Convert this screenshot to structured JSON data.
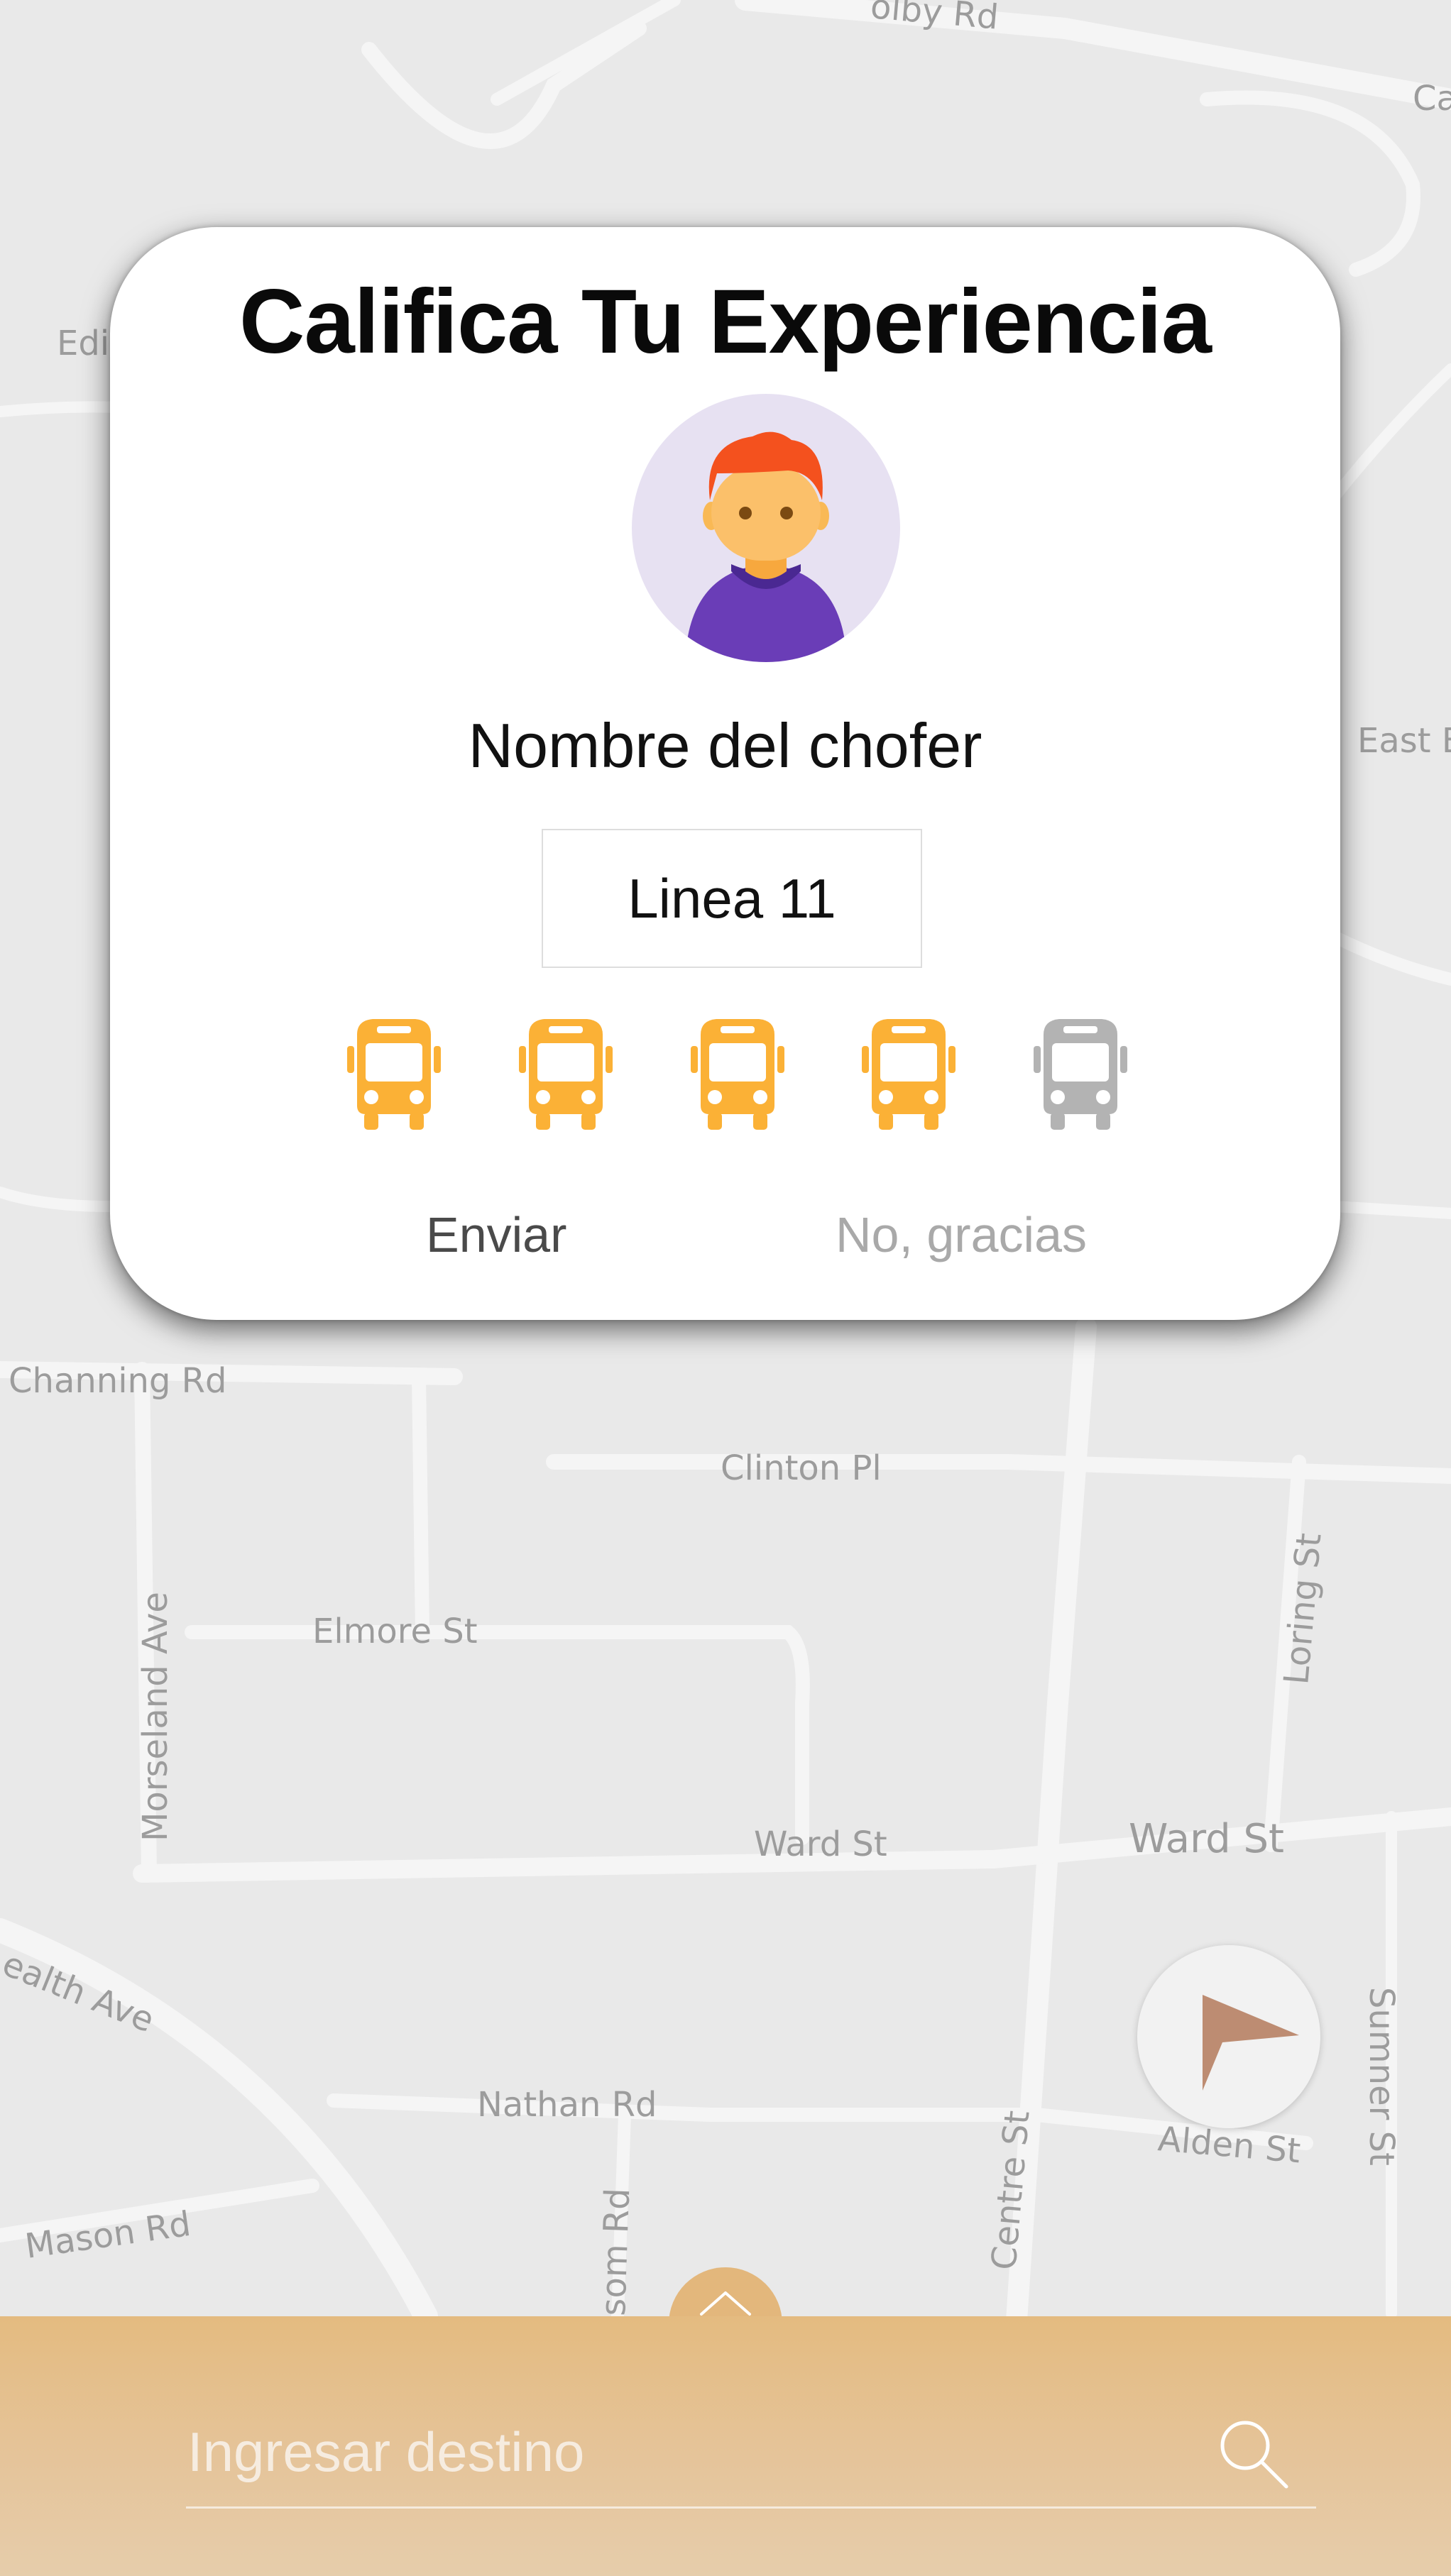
{
  "modal": {
    "title": "Califica Tu Experiencia",
    "driver_name": "Nombre del chofer",
    "route": "Linea 11",
    "rating": {
      "value": 4,
      "max": 5
    },
    "send_label": "Enviar",
    "dismiss_label": "No, gracias"
  },
  "map": {
    "streets": [
      "Channing Rd",
      "Clinton Pl",
      "Elmore St",
      "Morseland Ave",
      "Loring St",
      "Ward St",
      "Ward St",
      "ealth Ave",
      "Nathan Rd",
      "Alden St",
      "Sumner St",
      "Centre St",
      "Mason Rd",
      "som Rd",
      "East Buryi",
      "Edi",
      "Ca",
      "olby Rd"
    ]
  },
  "search": {
    "placeholder": "Ingresar destino",
    "value": ""
  },
  "icons": {
    "rating_icon": "bus-icon",
    "locate_icon": "navigation-arrow-icon",
    "expand_icon": "chevron-up-icon",
    "search_icon": "search-icon",
    "avatar_icon": "person-avatar-icon"
  },
  "colors": {
    "rating_active": "#fbb136",
    "rating_inactive": "#b3b3b3",
    "panel": "#e4bb80",
    "locate_arrow": "#bd8c72",
    "avatar_bg": "#e7e1f2"
  }
}
